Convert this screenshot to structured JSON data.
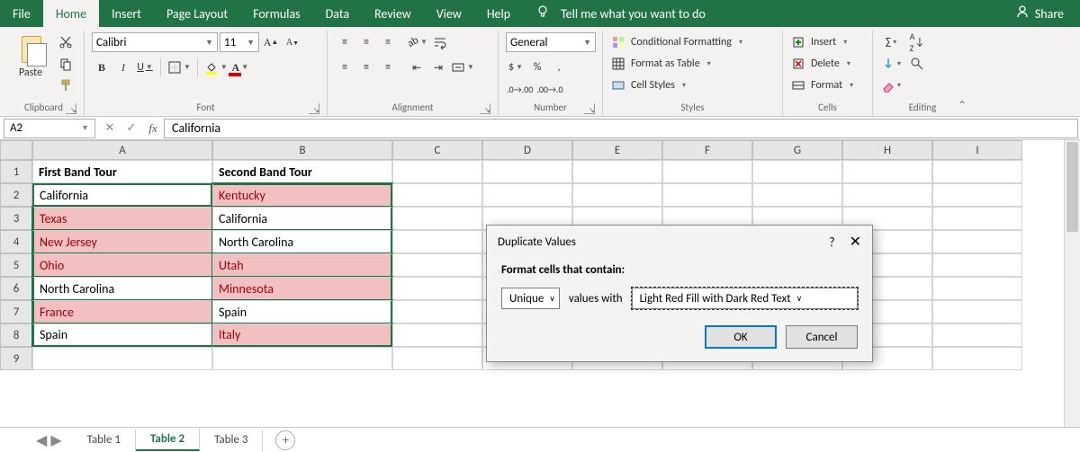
{
  "tabs": [
    "File",
    "Home",
    "Insert",
    "Page Layout",
    "Formulas",
    "Data",
    "Review",
    "View",
    "Help"
  ],
  "active_tab": "Home",
  "tell_me": "Tell me what you want to do",
  "share": "Share",
  "ribbon": {
    "clipboard": {
      "label": "Clipboard",
      "paste": "Paste"
    },
    "font": {
      "label": "Font",
      "name": "Calibri",
      "size": "11",
      "bold": "B",
      "italic": "I",
      "underline": "U"
    },
    "alignment": {
      "label": "Alignment"
    },
    "number": {
      "label": "Number",
      "format": "General",
      "currency": "$",
      "percent": "%",
      "comma": ","
    },
    "styles": {
      "label": "Styles",
      "cond": "Conditional Formatting",
      "table": "Format as Table",
      "cell": "Cell Styles"
    },
    "cells": {
      "label": "Cells",
      "insert": "Insert",
      "delete": "Delete",
      "format": "Format"
    },
    "editing": {
      "label": "Editing"
    }
  },
  "namebox": "A2",
  "formula": "California",
  "columns": [
    "A",
    "B",
    "C",
    "D",
    "E",
    "F",
    "G",
    "H",
    "I"
  ],
  "rows": [
    1,
    2,
    3,
    4,
    5,
    6,
    7,
    8,
    9
  ],
  "data_rows": [
    {
      "a": {
        "v": "First Band Tour",
        "hl": false,
        "hdr": true
      },
      "b": {
        "v": "Second Band Tour",
        "hl": false,
        "hdr": true
      }
    },
    {
      "a": {
        "v": "California",
        "hl": false
      },
      "b": {
        "v": "Kentucky",
        "hl": true
      }
    },
    {
      "a": {
        "v": "Texas",
        "hl": true
      },
      "b": {
        "v": "California",
        "hl": false
      }
    },
    {
      "a": {
        "v": "New Jersey",
        "hl": true
      },
      "b": {
        "v": "North Carolina",
        "hl": false
      }
    },
    {
      "a": {
        "v": "Ohio",
        "hl": true
      },
      "b": {
        "v": "Utah",
        "hl": true
      }
    },
    {
      "a": {
        "v": "North Carolina",
        "hl": false
      },
      "b": {
        "v": "Minnesota",
        "hl": true
      }
    },
    {
      "a": {
        "v": "France",
        "hl": true
      },
      "b": {
        "v": "Spain",
        "hl": false
      }
    },
    {
      "a": {
        "v": "Spain",
        "hl": false
      },
      "b": {
        "v": "Italy",
        "hl": true
      }
    }
  ],
  "sheet_tabs": [
    "Table 1",
    "Table 2",
    "Table 3"
  ],
  "active_sheet": "Table 2",
  "dialog": {
    "title": "Duplicate Values",
    "label": "Format cells that contain:",
    "mode": "Unique",
    "with_label": "values with",
    "style": "Light Red Fill with Dark Red Text",
    "ok": "OK",
    "cancel": "Cancel"
  }
}
